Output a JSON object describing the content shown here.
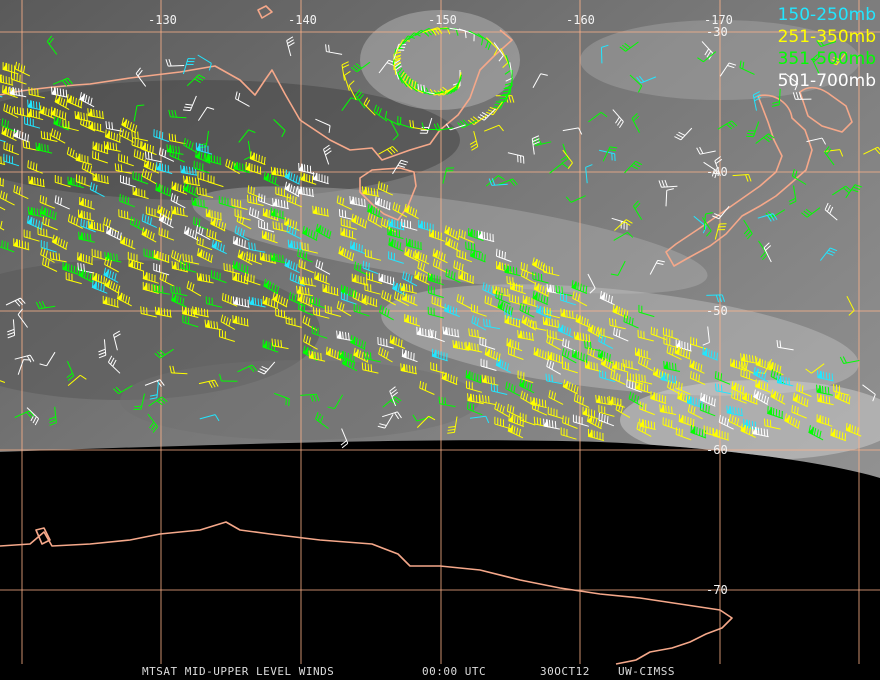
{
  "legend": [
    {
      "label": "150-250mb",
      "color": "#22e6ff"
    },
    {
      "label": "251-350mb",
      "color": "#ffff00"
    },
    {
      "label": "351-500mb",
      "color": "#00ff00"
    },
    {
      "label": "501-700mb",
      "color": "#ffffff"
    }
  ],
  "longitude_labels": [
    "-130",
    "-140",
    "-150",
    "-160",
    "-170"
  ],
  "latitude_labels": [
    "-30",
    "-40",
    "-50",
    "-60",
    "-70"
  ],
  "footer": {
    "product": "MTSAT MID-UPPER LEVEL WINDS",
    "time": "00:00 UTC",
    "date": "30OCT12",
    "credit": "UW-CIMSS"
  },
  "colors": {
    "grid": "#ffb38a",
    "coast": "#f5a88a",
    "space": "#000000"
  }
}
